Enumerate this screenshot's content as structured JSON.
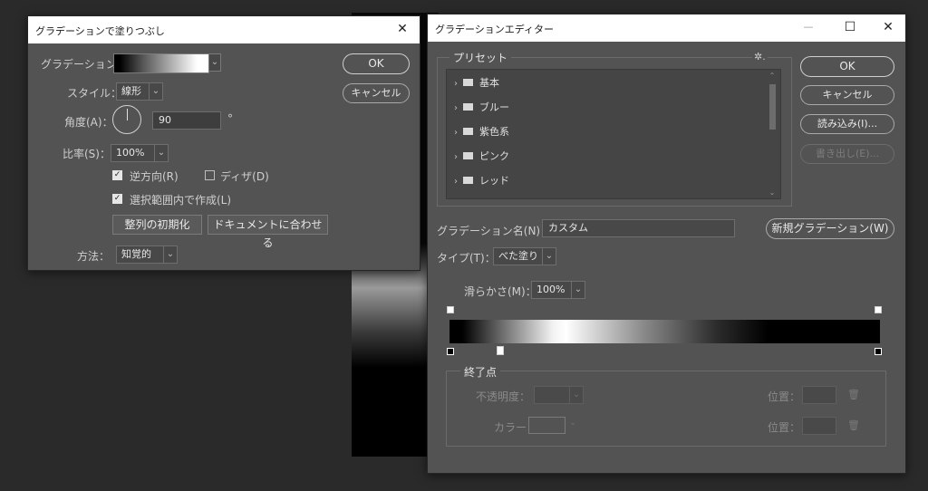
{
  "fill_dialog": {
    "title": "グラデーションで塗りつぶし",
    "close_glyph": "✕",
    "gradient_label": "グラデーション：",
    "style_label": "スタイル：",
    "style_value": "線形",
    "angle_label": "角度(A)：",
    "angle_value": "90",
    "angle_unit": "°",
    "scale_label": "比率(S)：",
    "scale_value": "100%",
    "reverse_label": "逆方向(R)",
    "reverse_checked": true,
    "dither_label": "ディザ(D)",
    "dither_checked": false,
    "selection_label": "選択範囲内で作成(L)",
    "selection_checked": true,
    "reset_align_button": "整列の初期化",
    "fit_document_button": "ドキュメントに合わせる",
    "method_label": "方法：",
    "method_value": "知覚的",
    "ok_button": "OK",
    "cancel_button": "キャンセル"
  },
  "editor_dialog": {
    "title": "グラデーションエディター",
    "minimize_glyph": "—",
    "maximize_glyph": "☐",
    "close_glyph": "✕",
    "presets_label": "プリセット",
    "presets_gear": "✲.",
    "presets": [
      {
        "label": "基本"
      },
      {
        "label": "ブルー"
      },
      {
        "label": "紫色系"
      },
      {
        "label": "ピンク"
      },
      {
        "label": "レッド"
      }
    ],
    "ok_button": "OK",
    "cancel_button": "キャンセル",
    "load_button": "読み込み(I)...",
    "export_button": "書き出し(E)...",
    "name_label": "グラデーション名(N)：",
    "name_value": "カスタム",
    "new_gradient_button": "新規グラデーション(W)",
    "type_label": "タイプ(T)：",
    "type_value": "べた塗り",
    "smoothness_label": "滑らかさ(M)：",
    "smoothness_value": "100%",
    "stops_group_label": "終了点",
    "opacity_label": "不透明度：",
    "location_label_1": "位置：",
    "color_label": "カラー：",
    "location_label_2": "位置：",
    "trash_glyph": "🗑"
  },
  "colors": {
    "dialog_bg": "#535353",
    "titlebar_bg": "#ffffff",
    "app_bg": "#2a2a2a"
  }
}
